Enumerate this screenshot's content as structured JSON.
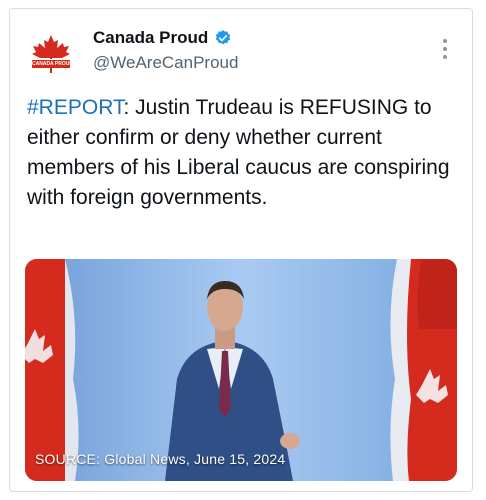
{
  "account": {
    "display_name": "Canada Proud",
    "handle": "@WeAreCanProud",
    "avatar_text": "CANADA PROUD",
    "verified": true
  },
  "tweet": {
    "hashtag": "#REPORT",
    "text": ": Justin Trudeau is REFUSING to either confirm or deny whether current members of his Liberal caucus are conspiring with foreign governments."
  },
  "media": {
    "caption": "SOURCE: Global News, June 15, 2024"
  },
  "colors": {
    "accent": "#1d6fb8",
    "verified": "#1d9bf0",
    "flag_red": "#d52b1e"
  },
  "icons": {
    "verified": "verified-badge-icon",
    "menu": "more-options-icon"
  }
}
